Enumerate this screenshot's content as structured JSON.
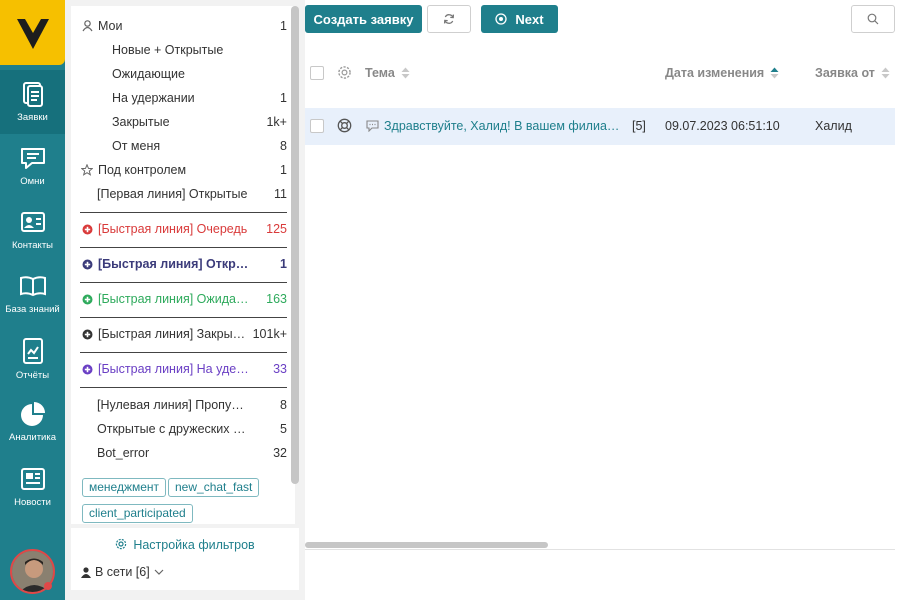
{
  "nav": {
    "items": [
      {
        "label": "Заявки",
        "icon": "tickets-icon",
        "active": true
      },
      {
        "label": "Омни",
        "icon": "chat-icon"
      },
      {
        "label": "Контакты",
        "icon": "contacts-icon"
      },
      {
        "label": "База знаний",
        "icon": "book-icon"
      },
      {
        "label": "Отчёты",
        "icon": "report-icon"
      },
      {
        "label": "Аналитика",
        "icon": "pie-chart-icon"
      },
      {
        "label": "Новости",
        "icon": "news-icon"
      }
    ]
  },
  "filters": {
    "items": [
      {
        "label": "Мои",
        "count": "1",
        "icon": "user-icon",
        "indent": false
      },
      {
        "label": "Новые + Открытые",
        "count": "",
        "indent": true
      },
      {
        "label": "Ожидающие",
        "count": "",
        "indent": true
      },
      {
        "label": "На удержании",
        "count": "1",
        "indent": true
      },
      {
        "label": "Закрытые",
        "count": "1k+",
        "indent": true
      },
      {
        "label": "От меня",
        "count": "8",
        "indent": true
      },
      {
        "label": "Под контролем",
        "count": "1",
        "icon": "star-icon",
        "indent": false
      },
      {
        "label": "[Первая линия] Открытые",
        "count": "11",
        "indent": false
      },
      {
        "label": "[Быстрая линия] Очередь",
        "count": "125",
        "color": "#d93a3a"
      },
      {
        "label": "[Быстрая линия] Открытые",
        "count": "1",
        "color": "#3b3b7a",
        "bold": true
      },
      {
        "label": "[Быстрая линия] Ожидающие",
        "count": "163",
        "color": "#2eaa5c"
      },
      {
        "label": "[Быстрая линия] Закрытые",
        "count": "101k+",
        "color": "#333333"
      },
      {
        "label": "[Быстрая линия] На удержании",
        "count": "33",
        "color": "#6a3fc4"
      },
      {
        "label": "[Нулевая линия] Пропущенные",
        "count": "8",
        "indent": false
      },
      {
        "label": "Открытые с дружеских отделов",
        "count": "5",
        "indent": false
      },
      {
        "label": "Bot_error",
        "count": "32",
        "indent": false
      }
    ],
    "tags": [
      "менеджмент",
      "new_chat_fast",
      "client_participated"
    ],
    "settings_label": "Настройка фильтров",
    "online_label": "В сети [6]"
  },
  "toolbar": {
    "create_label": "Создать заявку",
    "next_label": "Next"
  },
  "table": {
    "columns": [
      "Тема",
      "Дата изменения",
      "Заявка от"
    ],
    "rows": [
      {
        "subject": "Здравствуйте, Халид! В вашем филиале...",
        "count": "[5]",
        "date": "09.07.2023 06:51:10",
        "from": "Халид"
      }
    ]
  },
  "colors": {
    "accent": "#1f7f8c",
    "logo": "#f6c000",
    "row_highlight": "#e8f0fb"
  }
}
